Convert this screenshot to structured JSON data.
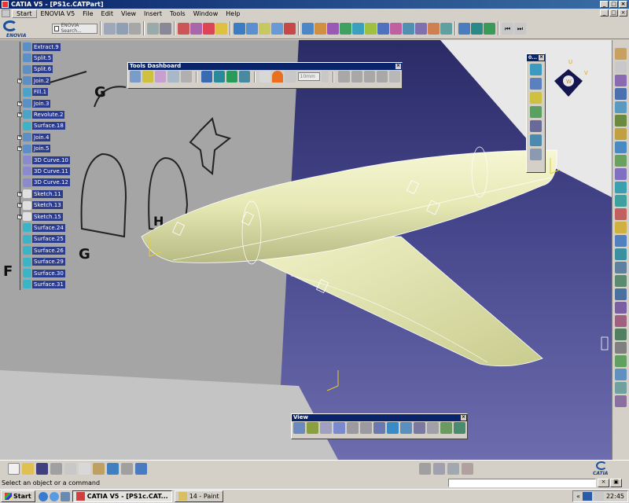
{
  "window": {
    "title": "CATIA V5 - [PS1c.CATPart]",
    "controls": [
      "_",
      "□",
      "×"
    ]
  },
  "menu": {
    "items": [
      "Start",
      "ENOVIA V5",
      "File",
      "Edit",
      "View",
      "Insert",
      "Tools",
      "Window",
      "Help"
    ],
    "doc_controls": [
      "_",
      "□",
      "×"
    ]
  },
  "toolbar": {
    "enovia_logo": "ENOVIA",
    "enovia_search": "ENOVIA Search..."
  },
  "spec_tree": {
    "items": [
      {
        "label": "Extract.9",
        "icon": "extract-icon",
        "toggle": "",
        "color": "#5b8fc7"
      },
      {
        "label": "Split.5",
        "icon": "split-icon",
        "toggle": "",
        "color": "#5b8fc7"
      },
      {
        "label": "Split.6",
        "icon": "split-icon",
        "toggle": "",
        "color": "#5b8fc7"
      },
      {
        "label": "Join.2",
        "icon": "join-icon",
        "toggle": "+",
        "color": "#5b8fc7"
      },
      {
        "label": "Fill.1",
        "icon": "fill-icon",
        "toggle": "",
        "color": "#4aa3c8"
      },
      {
        "label": "Join.3",
        "icon": "join-icon",
        "toggle": "+",
        "color": "#5b8fc7"
      },
      {
        "label": "Revolute.2",
        "icon": "revolute-icon",
        "toggle": "+",
        "color": "#4aa3c8"
      },
      {
        "label": "Surface.18",
        "icon": "surface-icon",
        "toggle": "",
        "color": "#3ab5c8"
      },
      {
        "label": "Join.4",
        "icon": "join-icon",
        "toggle": "+",
        "color": "#5b8fc7"
      },
      {
        "label": "Join.5",
        "icon": "join-icon",
        "toggle": "+",
        "color": "#5b8fc7"
      },
      {
        "label": "3D Curve.10",
        "icon": "curve-icon",
        "toggle": "",
        "color": "#8a8acf"
      },
      {
        "label": "3D Curve.11",
        "icon": "curve-icon",
        "toggle": "",
        "color": "#8a8acf"
      },
      {
        "label": "3D Curve.12",
        "icon": "curve-icon",
        "toggle": "",
        "color": "#8a8acf"
      },
      {
        "label": "Sketch.11",
        "icon": "sketch-icon",
        "toggle": "+",
        "color": "#e0e0e0"
      },
      {
        "label": "Sketch.13",
        "icon": "sketch-icon",
        "toggle": "+",
        "color": "#e0e0e0"
      },
      {
        "label": "Sketch.15",
        "icon": "sketch-icon",
        "toggle": "+",
        "color": "#e0e0e0"
      },
      {
        "label": "Surface.24",
        "icon": "surface-icon",
        "toggle": "",
        "color": "#3ab5c8"
      },
      {
        "label": "Surface.25",
        "icon": "surface-icon",
        "toggle": "",
        "color": "#3ab5c8"
      },
      {
        "label": "Surface.26",
        "icon": "surface-icon",
        "toggle": "",
        "color": "#3ab5c8"
      },
      {
        "label": "Surface.29",
        "icon": "surface-icon",
        "toggle": "",
        "color": "#3ab5c8"
      },
      {
        "label": "Surface.30",
        "icon": "surface-icon",
        "toggle": "",
        "color": "#3ab5c8"
      },
      {
        "label": "Surface.31",
        "icon": "surface-icon",
        "toggle": "",
        "color": "#3ab5c8"
      }
    ]
  },
  "tools_dashboard": {
    "title": "Tools Dashboard",
    "field_value": "10mm"
  },
  "view_toolbar": {
    "title": "View"
  },
  "mini_toolbar": {
    "title": "0..."
  },
  "sketch_letters": [
    "G",
    "H",
    "H",
    "H",
    "G",
    "F"
  ],
  "compass": {
    "u": "U",
    "v": "V",
    "w": "W"
  },
  "statusbar": {
    "message": "Select an object or a command"
  },
  "catia_logo": "CATIA",
  "taskbar": {
    "start": "Start",
    "tasks": [
      {
        "label": "CATIA V5 - [PS1c.CAT...",
        "active": true
      },
      {
        "label": "14 - Paint",
        "active": false
      }
    ],
    "tray_prefix": "«",
    "clock": "22:45"
  },
  "colors": {
    "viewport_top": "#2a2b66",
    "viewport_bottom": "#6c6cae",
    "fuselage": "#e6e8b4",
    "wing": "#dde0a6",
    "title_bar": "#0a246a",
    "tree_highlight": "#2b3c8e"
  }
}
